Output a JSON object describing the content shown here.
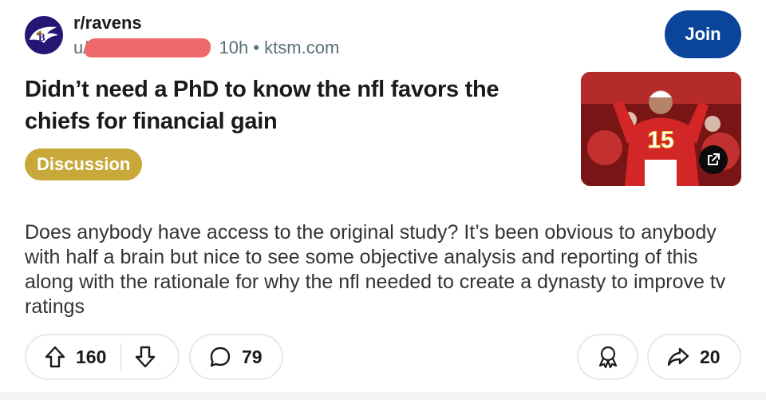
{
  "post": {
    "subreddit": "r/ravens",
    "user_prefix": "u/",
    "time": "10h",
    "separator": "•",
    "domain": "ktsm.com",
    "join_label": "Join",
    "title": "Didn’t need a PhD to know the nfl favors the chiefs for financial gain",
    "flair": "Discussion",
    "body": "Does anybody have access to the original study? It’s been obvious to anybody with half a brain but nice to see some objective analysis and reporting of this along with the rationale for why the nfl needed to create a dynasty to improve tv ratings",
    "thumbnail_jersey_number": "15"
  },
  "actions": {
    "upvotes": "160",
    "comments": "79",
    "shares": "20"
  },
  "icons": {
    "avatar": "ravens-logo-icon",
    "upvote": "arrow-up-icon",
    "downvote": "arrow-down-icon",
    "comment": "comment-bubble-icon",
    "award": "award-icon",
    "share": "share-arrow-icon",
    "external": "external-link-icon"
  },
  "colors": {
    "join_button": "#0a449b",
    "flair_bg": "#c9a83a",
    "redaction": "#ee6a6a",
    "avatar_bg": "#241773"
  }
}
